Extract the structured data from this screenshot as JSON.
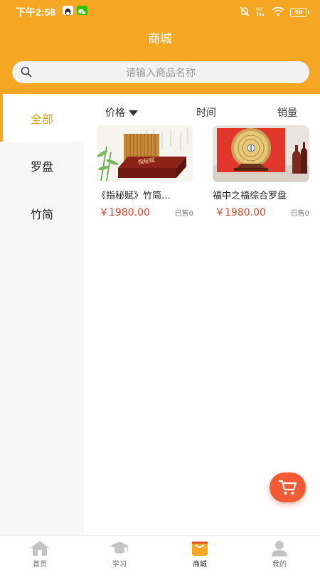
{
  "status_bar": {
    "time": "下午2:58",
    "battery": "56"
  },
  "header": {
    "title": "商城"
  },
  "search": {
    "placeholder": "请输入商品名称"
  },
  "sidebar": {
    "categories": [
      {
        "label": "全部",
        "active": true
      },
      {
        "label": "罗盘",
        "active": false
      },
      {
        "label": "竹简",
        "active": false
      }
    ]
  },
  "sort_bar": {
    "price": "价格",
    "time": "时间",
    "sales": "销量"
  },
  "products": [
    {
      "name": "《指秘赋》竹简…",
      "price": "￥1980.00",
      "sold": "已售0",
      "box_text": "指秘赋"
    },
    {
      "name": "福中之福综合罗盘",
      "price": "￥1980.00",
      "sold": "已售0"
    }
  ],
  "tabbar": {
    "items": [
      {
        "label": "首页",
        "icon": "home-icon"
      },
      {
        "label": "学习",
        "icon": "graduation-cap-icon"
      },
      {
        "label": "商城",
        "icon": "shopping-bag-icon",
        "active": true
      },
      {
        "label": "我的",
        "icon": "user-icon"
      }
    ]
  },
  "colors": {
    "primary": "#f5a623",
    "price": "#d0462f",
    "fab": "#f35b35",
    "active_category": "#d9a31c"
  }
}
